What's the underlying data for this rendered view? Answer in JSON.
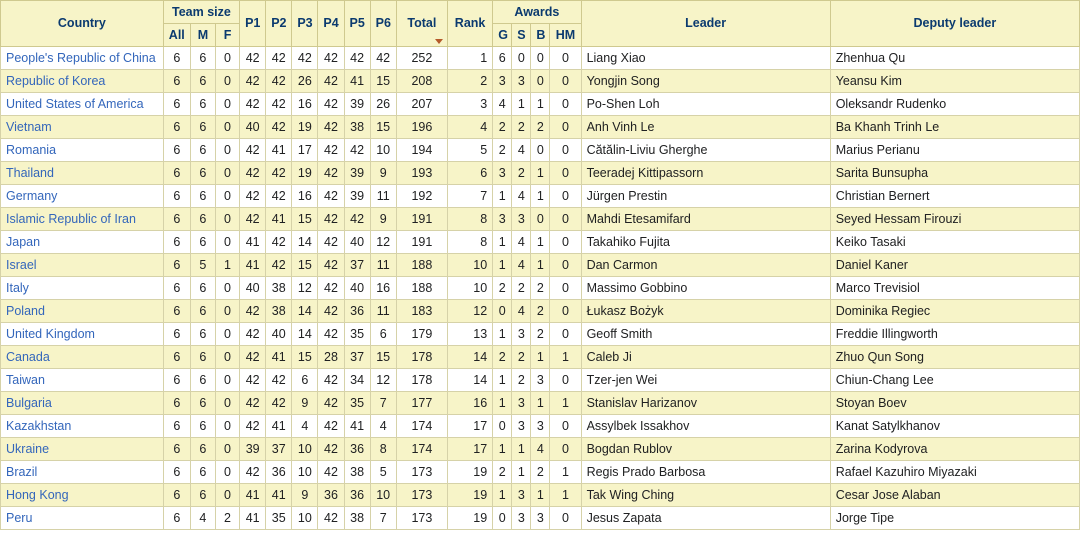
{
  "table": {
    "name": "imo-results-country-ranking",
    "headers": {
      "country": "Country",
      "team_size": "Team size",
      "all": "All",
      "m": "M",
      "f": "F",
      "p1": "P1",
      "p2": "P2",
      "p3": "P3",
      "p4": "P4",
      "p5": "P5",
      "p6": "P6",
      "total": "Total",
      "rank": "Rank",
      "awards": "Awards",
      "g": "G",
      "s": "S",
      "b": "B",
      "hm": "HM",
      "leader": "Leader",
      "deputy_leader": "Deputy leader"
    },
    "sort": {
      "column": "Total",
      "direction": "descending",
      "icon": "sort-descending-arrow-icon"
    },
    "colors": {
      "header_background": "#f7f4c8",
      "header_text": "#0b3a6f",
      "row_alt_background": "#f7f4c8",
      "row_background": "#ffffff",
      "border": "#d6d2a8",
      "link": "#3366bb",
      "sort_arrow": "#b55a2a"
    },
    "rows": [
      {
        "country": "People's Republic of China",
        "all": "6",
        "m": "6",
        "f": "0",
        "p1": "42",
        "p2": "42",
        "p3": "42",
        "p4": "42",
        "p5": "42",
        "p6": "42",
        "total": "252",
        "rank": "1",
        "g": "6",
        "s": "0",
        "b": "0",
        "hm": "0",
        "leader": "Liang Xiao",
        "deputy": "Zhenhua Qu"
      },
      {
        "country": "Republic of Korea",
        "all": "6",
        "m": "6",
        "f": "0",
        "p1": "42",
        "p2": "42",
        "p3": "26",
        "p4": "42",
        "p5": "41",
        "p6": "15",
        "total": "208",
        "rank": "2",
        "g": "3",
        "s": "3",
        "b": "0",
        "hm": "0",
        "leader": "Yongjin Song",
        "deputy": "Yeansu Kim"
      },
      {
        "country": "United States of America",
        "all": "6",
        "m": "6",
        "f": "0",
        "p1": "42",
        "p2": "42",
        "p3": "16",
        "p4": "42",
        "p5": "39",
        "p6": "26",
        "total": "207",
        "rank": "3",
        "g": "4",
        "s": "1",
        "b": "1",
        "hm": "0",
        "leader": "Po-Shen Loh",
        "deputy": "Oleksandr Rudenko"
      },
      {
        "country": "Vietnam",
        "all": "6",
        "m": "6",
        "f": "0",
        "p1": "40",
        "p2": "42",
        "p3": "19",
        "p4": "42",
        "p5": "38",
        "p6": "15",
        "total": "196",
        "rank": "4",
        "g": "2",
        "s": "2",
        "b": "2",
        "hm": "0",
        "leader": "Anh Vinh Le",
        "deputy": "Ba Khanh Trinh Le"
      },
      {
        "country": "Romania",
        "all": "6",
        "m": "6",
        "f": "0",
        "p1": "42",
        "p2": "41",
        "p3": "17",
        "p4": "42",
        "p5": "42",
        "p6": "10",
        "total": "194",
        "rank": "5",
        "g": "2",
        "s": "4",
        "b": "0",
        "hm": "0",
        "leader": "Cătălin-Liviu Gherghe",
        "deputy": "Marius Perianu"
      },
      {
        "country": "Thailand",
        "all": "6",
        "m": "6",
        "f": "0",
        "p1": "42",
        "p2": "42",
        "p3": "19",
        "p4": "42",
        "p5": "39",
        "p6": "9",
        "total": "193",
        "rank": "6",
        "g": "3",
        "s": "2",
        "b": "1",
        "hm": "0",
        "leader": "Teeradej Kittipassorn",
        "deputy": "Sarita Bunsupha"
      },
      {
        "country": "Germany",
        "all": "6",
        "m": "6",
        "f": "0",
        "p1": "42",
        "p2": "42",
        "p3": "16",
        "p4": "42",
        "p5": "39",
        "p6": "11",
        "total": "192",
        "rank": "7",
        "g": "1",
        "s": "4",
        "b": "1",
        "hm": "0",
        "leader": "Jürgen Prestin",
        "deputy": "Christian Bernert"
      },
      {
        "country": "Islamic Republic of Iran",
        "all": "6",
        "m": "6",
        "f": "0",
        "p1": "42",
        "p2": "41",
        "p3": "15",
        "p4": "42",
        "p5": "42",
        "p6": "9",
        "total": "191",
        "rank": "8",
        "g": "3",
        "s": "3",
        "b": "0",
        "hm": "0",
        "leader": "Mahdi Etesamifard",
        "deputy": "Seyed Hessam Firouzi"
      },
      {
        "country": "Japan",
        "all": "6",
        "m": "6",
        "f": "0",
        "p1": "41",
        "p2": "42",
        "p3": "14",
        "p4": "42",
        "p5": "40",
        "p6": "12",
        "total": "191",
        "rank": "8",
        "g": "1",
        "s": "4",
        "b": "1",
        "hm": "0",
        "leader": "Takahiko Fujita",
        "deputy": "Keiko Tasaki"
      },
      {
        "country": "Israel",
        "all": "6",
        "m": "5",
        "f": "1",
        "p1": "41",
        "p2": "42",
        "p3": "15",
        "p4": "42",
        "p5": "37",
        "p6": "11",
        "total": "188",
        "rank": "10",
        "g": "1",
        "s": "4",
        "b": "1",
        "hm": "0",
        "leader": "Dan Carmon",
        "deputy": "Daniel Kaner"
      },
      {
        "country": "Italy",
        "all": "6",
        "m": "6",
        "f": "0",
        "p1": "40",
        "p2": "38",
        "p3": "12",
        "p4": "42",
        "p5": "40",
        "p6": "16",
        "total": "188",
        "rank": "10",
        "g": "2",
        "s": "2",
        "b": "2",
        "hm": "0",
        "leader": "Massimo Gobbino",
        "deputy": "Marco Trevisiol"
      },
      {
        "country": "Poland",
        "all": "6",
        "m": "6",
        "f": "0",
        "p1": "42",
        "p2": "38",
        "p3": "14",
        "p4": "42",
        "p5": "36",
        "p6": "11",
        "total": "183",
        "rank": "12",
        "g": "0",
        "s": "4",
        "b": "2",
        "hm": "0",
        "leader": "Łukasz Bożyk",
        "deputy": "Dominika Regiec"
      },
      {
        "country": "United Kingdom",
        "all": "6",
        "m": "6",
        "f": "0",
        "p1": "42",
        "p2": "40",
        "p3": "14",
        "p4": "42",
        "p5": "35",
        "p6": "6",
        "total": "179",
        "rank": "13",
        "g": "1",
        "s": "3",
        "b": "2",
        "hm": "0",
        "leader": "Geoff Smith",
        "deputy": "Freddie Illingworth"
      },
      {
        "country": "Canada",
        "all": "6",
        "m": "6",
        "f": "0",
        "p1": "42",
        "p2": "41",
        "p3": "15",
        "p4": "28",
        "p5": "37",
        "p6": "15",
        "total": "178",
        "rank": "14",
        "g": "2",
        "s": "2",
        "b": "1",
        "hm": "1",
        "leader": "Caleb Ji",
        "deputy": "Zhuo Qun Song"
      },
      {
        "country": "Taiwan",
        "all": "6",
        "m": "6",
        "f": "0",
        "p1": "42",
        "p2": "42",
        "p3": "6",
        "p4": "42",
        "p5": "34",
        "p6": "12",
        "total": "178",
        "rank": "14",
        "g": "1",
        "s": "2",
        "b": "3",
        "hm": "0",
        "leader": "Tzer-jen Wei",
        "deputy": "Chiun-Chang Lee"
      },
      {
        "country": "Bulgaria",
        "all": "6",
        "m": "6",
        "f": "0",
        "p1": "42",
        "p2": "42",
        "p3": "9",
        "p4": "42",
        "p5": "35",
        "p6": "7",
        "total": "177",
        "rank": "16",
        "g": "1",
        "s": "3",
        "b": "1",
        "hm": "1",
        "leader": "Stanislav Harizanov",
        "deputy": "Stoyan Boev"
      },
      {
        "country": "Kazakhstan",
        "all": "6",
        "m": "6",
        "f": "0",
        "p1": "42",
        "p2": "41",
        "p3": "4",
        "p4": "42",
        "p5": "41",
        "p6": "4",
        "total": "174",
        "rank": "17",
        "g": "0",
        "s": "3",
        "b": "3",
        "hm": "0",
        "leader": "Assylbek Issakhov",
        "deputy": "Kanat Satylkhanov"
      },
      {
        "country": "Ukraine",
        "all": "6",
        "m": "6",
        "f": "0",
        "p1": "39",
        "p2": "37",
        "p3": "10",
        "p4": "42",
        "p5": "36",
        "p6": "8",
        "total": "174",
        "rank": "17",
        "g": "1",
        "s": "1",
        "b": "4",
        "hm": "0",
        "leader": "Bogdan Rublov",
        "deputy": "Zarina Kodyrova"
      },
      {
        "country": "Brazil",
        "all": "6",
        "m": "6",
        "f": "0",
        "p1": "42",
        "p2": "36",
        "p3": "10",
        "p4": "42",
        "p5": "38",
        "p6": "5",
        "total": "173",
        "rank": "19",
        "g": "2",
        "s": "1",
        "b": "2",
        "hm": "1",
        "leader": "Regis Prado Barbosa",
        "deputy": "Rafael Kazuhiro Miyazaki"
      },
      {
        "country": "Hong Kong",
        "all": "6",
        "m": "6",
        "f": "0",
        "p1": "41",
        "p2": "41",
        "p3": "9",
        "p4": "36",
        "p5": "36",
        "p6": "10",
        "total": "173",
        "rank": "19",
        "g": "1",
        "s": "3",
        "b": "1",
        "hm": "1",
        "leader": "Tak Wing Ching",
        "deputy": "Cesar Jose Alaban"
      },
      {
        "country": "Peru",
        "all": "6",
        "m": "4",
        "f": "2",
        "p1": "41",
        "p2": "35",
        "p3": "10",
        "p4": "42",
        "p5": "38",
        "p6": "7",
        "total": "173",
        "rank": "19",
        "g": "0",
        "s": "3",
        "b": "3",
        "hm": "0",
        "leader": "Jesus Zapata",
        "deputy": "Jorge Tipe"
      }
    ]
  }
}
